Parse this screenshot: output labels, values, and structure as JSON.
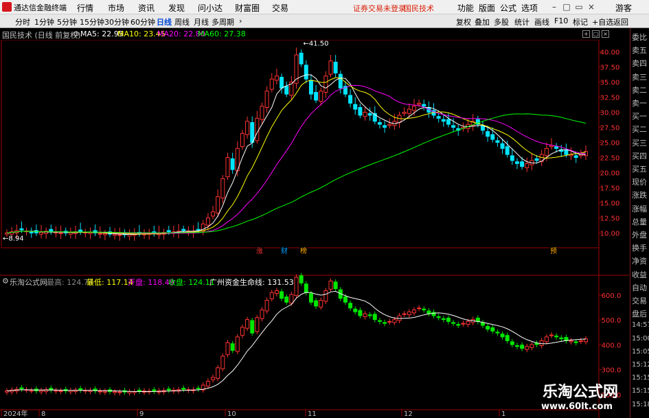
{
  "app": {
    "title": "通达信金融终端",
    "menus": [
      "行情",
      "市场",
      "资讯",
      "发现",
      "问小达",
      "财富圈",
      "交易"
    ],
    "status_text": "证券交易未登录",
    "stock_name": "国民技术",
    "right_menus": [
      "功能",
      "版面",
      "公式",
      "选项"
    ],
    "guest_label": "游客"
  },
  "toolbar": {
    "periods": [
      "分时",
      "1分钟",
      "5分钟",
      "15分钟",
      "30分钟",
      "60分钟",
      "日线",
      "周线",
      "月线",
      "多周期"
    ],
    "active_period": "日线",
    "right_buttons": [
      "复权",
      "叠加",
      "多股",
      "统计",
      "画线",
      "F10",
      "标记",
      "+自选",
      "返回"
    ]
  },
  "kline_info": {
    "title": "国民技术 (日线 前复权)",
    "ma5": "MA5: 22.95",
    "ma10": "MA10: 23.45",
    "ma20": "MA20: 22.80",
    "ma60": "MA60: 27.38"
  },
  "indicator_info": {
    "name": "乐淘公式网",
    "high": "最高: 124.74",
    "low": "最低: 117.14",
    "open": "开盘: 118.49",
    "close": "收盘: 124.11",
    "lifeline": "广州资金生命线: 131.53"
  },
  "price_axis": [
    "40.00",
    "37.50",
    "35.00",
    "32.50",
    "30.00",
    "27.50",
    "25.00",
    "22.50",
    "20.00",
    "17.50",
    "15.00",
    "12.50",
    "10.00"
  ],
  "indicator_axis": [
    "600.0",
    "500.0",
    "400.0",
    "300.0",
    "200.0"
  ],
  "annotations": {
    "high_label": "41.50",
    "low_label": "8.94",
    "events": [
      "涨",
      "财",
      "榜",
      "预"
    ]
  },
  "time_axis": [
    "2024年",
    "8",
    "9",
    "10",
    "11",
    "12",
    "1"
  ],
  "side_panel": [
    "委比",
    "卖五",
    "卖四",
    "卖三",
    "卖二",
    "卖一",
    "买一",
    "买二",
    "买三",
    "买四",
    "买五",
    "现价",
    "涨跌",
    "涨幅",
    "总量",
    "外盘",
    "换手",
    "净资",
    "收益",
    "自动",
    "交易",
    "盘后",
    "14:57",
    "15:00",
    "15:05",
    "15:12",
    "15:15",
    "15:15",
    "15:18"
  ],
  "watermark": {
    "line1": "乐淘公式网",
    "line2": "www.60lt.com"
  },
  "colors": {
    "up": "#ff3232",
    "down": "#00e4ff",
    "ma5": "#ffffff",
    "ma10": "#ffff00",
    "ma20": "#ff00ff",
    "ma60": "#00ff00",
    "indicator_up": "#ff3232",
    "indicator_down": "#00e600",
    "axis_frame": "#a00000"
  },
  "chart_data": {
    "type": "line",
    "main": {
      "ylim": [
        8.0,
        42.0
      ],
      "closes": [
        10.0,
        10.2,
        10.4,
        10.5,
        10.3,
        10.1,
        10.0,
        10.1,
        10.3,
        10.2,
        10.1,
        10.0,
        10.0,
        10.1,
        10.2,
        10.2,
        10.1,
        10.1,
        10.0,
        9.9,
        9.9,
        9.8,
        9.8,
        9.7,
        9.7,
        9.8,
        9.8,
        9.9,
        10.0,
        9.9,
        9.9,
        10.0,
        10.1,
        10.2,
        10.2,
        10.3,
        10.4,
        10.3,
        10.3,
        10.5,
        11.5,
        12.5,
        13.5,
        16.0,
        19.0,
        22.5,
        20.5,
        24.0,
        26.5,
        28.5,
        25.0,
        29.0,
        31.0,
        33.5,
        35.5,
        36.0,
        34.0,
        33.0,
        35.0,
        39.5,
        38.0,
        35.5,
        33.0,
        32.0,
        33.5,
        36.0,
        38.5,
        36.5,
        34.0,
        33.0,
        31.5,
        30.5,
        29.5,
        30.0,
        29.5,
        28.5,
        28.0,
        27.5,
        28.0,
        28.5,
        29.5,
        30.0,
        30.5,
        31.0,
        31.5,
        31.0,
        30.0,
        29.5,
        29.0,
        28.5,
        28.0,
        27.5,
        27.0,
        27.5,
        28.0,
        28.5,
        28.0,
        27.0,
        26.0,
        25.5,
        25.0,
        24.0,
        23.0,
        22.0,
        21.5,
        21.0,
        21.5,
        22.0,
        22.0,
        23.0,
        24.0,
        24.5,
        24.0,
        23.5,
        23.0,
        23.0,
        22.5,
        23.0,
        23.5
      ],
      "series": [
        {
          "name": "MA5",
          "last": 22.95
        },
        {
          "name": "MA10",
          "last": 23.45
        },
        {
          "name": "MA20",
          "last": 22.8
        },
        {
          "name": "MA60",
          "last": 27.38
        }
      ]
    },
    "indicator": {
      "ylim": [
        150,
        680
      ],
      "name": "广州资金生命线",
      "last": 131.53
    }
  }
}
